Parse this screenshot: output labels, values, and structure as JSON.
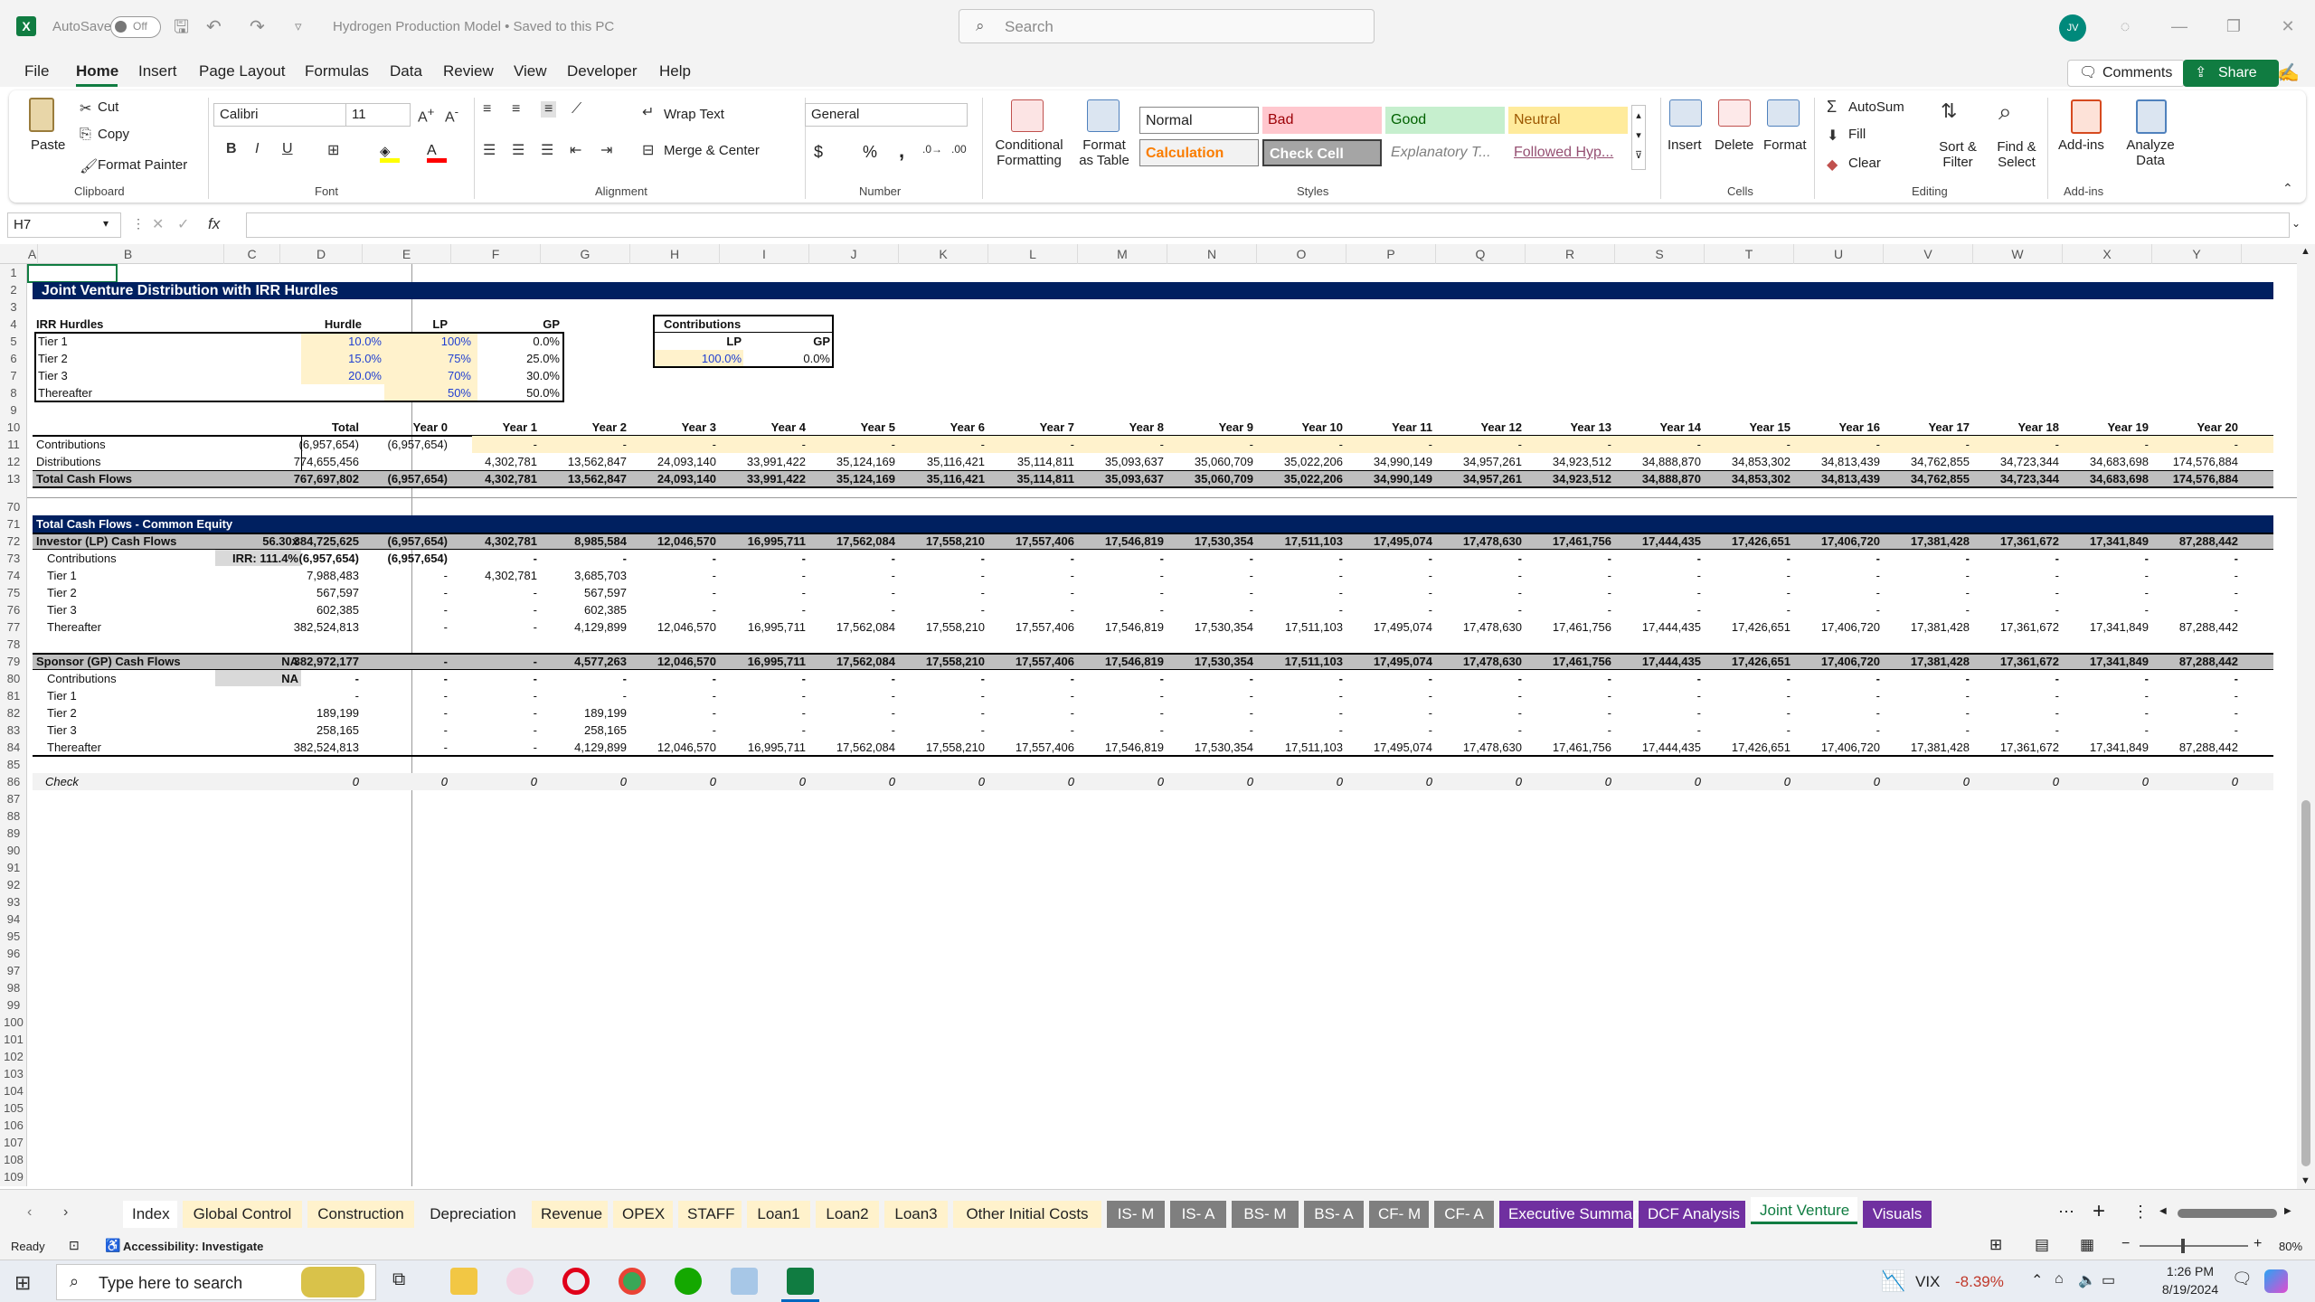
{
  "titlebar": {
    "autosave_label": "AutoSave",
    "autosave_state": "Off",
    "document_title": "Hydrogen Production Model • Saved to this PC",
    "search_placeholder": "Search",
    "user_initials": "JV"
  },
  "menu": {
    "tabs": [
      "File",
      "Home",
      "Insert",
      "Page Layout",
      "Formulas",
      "Data",
      "Review",
      "View",
      "Developer",
      "Help"
    ],
    "active": "Home",
    "comments_label": "Comments",
    "share_label": "Share"
  },
  "ribbon": {
    "clipboard": {
      "paste": "Paste",
      "cut": "Cut",
      "copy": "Copy",
      "format_painter": "Format Painter",
      "group": "Clipboard"
    },
    "font": {
      "name": "Calibri",
      "size": "11",
      "group": "Font"
    },
    "alignment": {
      "wrap_text": "Wrap Text",
      "merge_center": "Merge & Center",
      "group": "Alignment"
    },
    "number": {
      "format": "General",
      "currency": "$",
      "percent": "%",
      "comma": ",",
      "group": "Number"
    },
    "styles": {
      "conditional_formatting": "Conditional Formatting",
      "format_as_table": "Format as Table",
      "normal": "Normal",
      "bad": "Bad",
      "good": "Good",
      "neutral": "Neutral",
      "calculation": "Calculation",
      "check_cell": "Check Cell",
      "explanatory": "Explanatory T...",
      "followed": "Followed Hyp...",
      "group": "Styles"
    },
    "cells": {
      "insert": "Insert",
      "delete": "Delete",
      "format": "Format",
      "group": "Cells"
    },
    "editing": {
      "autosum": "AutoSum",
      "fill": "Fill",
      "clear": "Clear",
      "sort_filter": "Sort & Filter",
      "find_select": "Find & Select",
      "group": "Editing"
    },
    "addins": {
      "addins": "Add-ins",
      "analyze": "Analyze Data",
      "group": "Add-ins"
    }
  },
  "formula_bar": {
    "name_box": "H7",
    "fx": "fx",
    "content": ""
  },
  "columns": [
    "A",
    "B",
    "C",
    "D",
    "E",
    "F",
    "G",
    "H",
    "I",
    "J",
    "K",
    "L",
    "M",
    "N",
    "O",
    "P",
    "Q",
    "R",
    "S",
    "T",
    "U",
    "V",
    "W",
    "X",
    "Y"
  ],
  "row_numbers": [
    "1",
    "2",
    "3",
    "4",
    "5",
    "6",
    "7",
    "8",
    "9",
    "10",
    "11",
    "12",
    "13",
    "70",
    "71",
    "72",
    "73",
    "74",
    "75",
    "76",
    "77",
    "78",
    "79",
    "80",
    "81",
    "82",
    "83",
    "84",
    "85",
    "86",
    "87",
    "88",
    "89",
    "90",
    "91",
    "92",
    "93",
    "94",
    "95",
    "96",
    "97",
    "98",
    "99",
    "100",
    "101",
    "102",
    "103",
    "104",
    "105",
    "106",
    "107",
    "108",
    "109"
  ],
  "sheet": {
    "title": "Joint Venture Distribution with IRR Hurdles",
    "hurdles_header": {
      "label": "IRR Hurdles",
      "hurdle": "Hurdle",
      "lp": "LP",
      "gp": "GP"
    },
    "hurdles": [
      {
        "label": "Tier 1",
        "hurdle": "10.0%",
        "lp": "100%",
        "gp": "0.0%"
      },
      {
        "label": "Tier 2",
        "hurdle": "15.0%",
        "lp": "75%",
        "gp": "25.0%"
      },
      {
        "label": "Tier 3",
        "hurdle": "20.0%",
        "lp": "70%",
        "gp": "30.0%"
      },
      {
        "label": "Thereafter",
        "hurdle": "",
        "lp": "50%",
        "gp": "50.0%"
      }
    ],
    "contributions_box": {
      "title": "Contributions",
      "lp_label": "LP",
      "gp_label": "GP",
      "lp": "100.0%",
      "gp": "0.0%"
    },
    "year_header": [
      "Total",
      "Year 0",
      "Year 1",
      "Year 2",
      "Year 3",
      "Year 4",
      "Year 5",
      "Year 6",
      "Year 7",
      "Year 8",
      "Year 9",
      "Year 10",
      "Year 11",
      "Year 12",
      "Year 13",
      "Year 14",
      "Year 15",
      "Year 16",
      "Year 17",
      "Year 18",
      "Year 19",
      "Year 20"
    ],
    "cf_rows": [
      {
        "label": "Contributions",
        "values": [
          "(6,957,654)",
          "(6,957,654)",
          "-",
          "-",
          "-",
          "-",
          "-",
          "-",
          "-",
          "-",
          "-",
          "-",
          "-",
          "-",
          "-",
          "-",
          "-",
          "-",
          "-",
          "-",
          "-",
          "-"
        ]
      },
      {
        "label": "Distributions",
        "values": [
          "774,655,456",
          "",
          "4,302,781",
          "13,562,847",
          "24,093,140",
          "33,991,422",
          "35,124,169",
          "35,116,421",
          "35,114,811",
          "35,093,637",
          "35,060,709",
          "35,022,206",
          "34,990,149",
          "34,957,261",
          "34,923,512",
          "34,888,870",
          "34,853,302",
          "34,813,439",
          "34,762,855",
          "34,723,344",
          "34,683,698",
          "174,576,884"
        ]
      },
      {
        "label": "Total Cash Flows",
        "values": [
          "767,697,802",
          "(6,957,654)",
          "4,302,781",
          "13,562,847",
          "24,093,140",
          "33,991,422",
          "35,124,169",
          "35,116,421",
          "35,114,811",
          "35,093,637",
          "35,060,709",
          "35,022,206",
          "34,990,149",
          "34,957,261",
          "34,923,512",
          "34,888,870",
          "34,853,302",
          "34,813,439",
          "34,762,855",
          "34,723,344",
          "34,683,698",
          "174,576,884"
        ]
      }
    ],
    "common_equity_title": "Total Cash Flows - Common Equity",
    "lp_section": {
      "label": "Investor (LP) Cash Flows",
      "multiple": "56.30x",
      "values": [
        "384,725,625",
        "(6,957,654)",
        "4,302,781",
        "8,985,584",
        "12,046,570",
        "16,995,711",
        "17,562,084",
        "17,558,210",
        "17,557,406",
        "17,546,819",
        "17,530,354",
        "17,511,103",
        "17,495,074",
        "17,478,630",
        "17,461,756",
        "17,444,435",
        "17,426,651",
        "17,406,720",
        "17,381,428",
        "17,361,672",
        "17,341,849",
        "87,288,442"
      ],
      "rows": [
        {
          "label": "Contributions",
          "note": "IRR: 111.4%",
          "values": [
            "(6,957,654)",
            "(6,957,654)",
            "-",
            "-",
            "-",
            "-",
            "-",
            "-",
            "-",
            "-",
            "-",
            "-",
            "-",
            "-",
            "-",
            "-",
            "-",
            "-",
            "-",
            "-",
            "-",
            "-"
          ]
        },
        {
          "label": "Tier 1",
          "note": "",
          "values": [
            "7,988,483",
            "-",
            "4,302,781",
            "3,685,703",
            "-",
            "-",
            "-",
            "-",
            "-",
            "-",
            "-",
            "-",
            "-",
            "-",
            "-",
            "-",
            "-",
            "-",
            "-",
            "-",
            "-",
            "-"
          ]
        },
        {
          "label": "Tier 2",
          "note": "",
          "values": [
            "567,597",
            "-",
            "-",
            "567,597",
            "-",
            "-",
            "-",
            "-",
            "-",
            "-",
            "-",
            "-",
            "-",
            "-",
            "-",
            "-",
            "-",
            "-",
            "-",
            "-",
            "-",
            "-"
          ]
        },
        {
          "label": "Tier 3",
          "note": "",
          "values": [
            "602,385",
            "-",
            "-",
            "602,385",
            "-",
            "-",
            "-",
            "-",
            "-",
            "-",
            "-",
            "-",
            "-",
            "-",
            "-",
            "-",
            "-",
            "-",
            "-",
            "-",
            "-",
            "-"
          ]
        },
        {
          "label": "Thereafter",
          "note": "",
          "values": [
            "382,524,813",
            "-",
            "-",
            "4,129,899",
            "12,046,570",
            "16,995,711",
            "17,562,084",
            "17,558,210",
            "17,557,406",
            "17,546,819",
            "17,530,354",
            "17,511,103",
            "17,495,074",
            "17,478,630",
            "17,461,756",
            "17,444,435",
            "17,426,651",
            "17,406,720",
            "17,381,428",
            "17,361,672",
            "17,341,849",
            "87,288,442"
          ]
        }
      ]
    },
    "gp_section": {
      "label": "Sponsor (GP) Cash Flows",
      "multiple": "NA",
      "values": [
        "382,972,177",
        "-",
        "-",
        "4,577,263",
        "12,046,570",
        "16,995,711",
        "17,562,084",
        "17,558,210",
        "17,557,406",
        "17,546,819",
        "17,530,354",
        "17,511,103",
        "17,495,074",
        "17,478,630",
        "17,461,756",
        "17,444,435",
        "17,426,651",
        "17,406,720",
        "17,381,428",
        "17,361,672",
        "17,341,849",
        "87,288,442"
      ],
      "rows": [
        {
          "label": "Contributions",
          "note": "NA",
          "values": [
            "-",
            "-",
            "-",
            "-",
            "-",
            "-",
            "-",
            "-",
            "-",
            "-",
            "-",
            "-",
            "-",
            "-",
            "-",
            "-",
            "-",
            "-",
            "-",
            "-",
            "-",
            "-"
          ]
        },
        {
          "label": "Tier 1",
          "note": "",
          "values": [
            "-",
            "-",
            "-",
            "-",
            "-",
            "-",
            "-",
            "-",
            "-",
            "-",
            "-",
            "-",
            "-",
            "-",
            "-",
            "-",
            "-",
            "-",
            "-",
            "-",
            "-",
            "-"
          ]
        },
        {
          "label": "Tier 2",
          "note": "",
          "values": [
            "189,199",
            "-",
            "-",
            "189,199",
            "-",
            "-",
            "-",
            "-",
            "-",
            "-",
            "-",
            "-",
            "-",
            "-",
            "-",
            "-",
            "-",
            "-",
            "-",
            "-",
            "-",
            "-"
          ]
        },
        {
          "label": "Tier 3",
          "note": "",
          "values": [
            "258,165",
            "-",
            "-",
            "258,165",
            "-",
            "-",
            "-",
            "-",
            "-",
            "-",
            "-",
            "-",
            "-",
            "-",
            "-",
            "-",
            "-",
            "-",
            "-",
            "-",
            "-",
            "-"
          ]
        },
        {
          "label": "Thereafter",
          "note": "",
          "values": [
            "382,524,813",
            "-",
            "-",
            "4,129,899",
            "12,046,570",
            "16,995,711",
            "17,562,084",
            "17,558,210",
            "17,557,406",
            "17,546,819",
            "17,530,354",
            "17,511,103",
            "17,495,074",
            "17,478,630",
            "17,461,756",
            "17,444,435",
            "17,426,651",
            "17,406,720",
            "17,381,428",
            "17,361,672",
            "17,341,849",
            "87,288,442"
          ]
        }
      ]
    },
    "check": {
      "label": "Check",
      "values": [
        "0",
        "0",
        "0",
        "0",
        "0",
        "0",
        "0",
        "0",
        "0",
        "0",
        "0",
        "0",
        "0",
        "0",
        "0",
        "0",
        "0",
        "0",
        "0",
        "0",
        "0",
        "0"
      ]
    }
  },
  "sheet_tabs": [
    {
      "name": "Index",
      "color": "#ffffff"
    },
    {
      "name": "Global Control",
      "color": "#fff2cc"
    },
    {
      "name": "Construction",
      "color": "#fff2cc"
    },
    {
      "name": "Depreciation",
      "color": "#f3f3f3"
    },
    {
      "name": "Revenue",
      "color": "#fff2cc"
    },
    {
      "name": "OPEX",
      "color": "#fff2cc"
    },
    {
      "name": "STAFF",
      "color": "#fff2cc"
    },
    {
      "name": "Loan1",
      "color": "#fff2cc"
    },
    {
      "name": "Loan2",
      "color": "#fff2cc"
    },
    {
      "name": "Loan3",
      "color": "#fff2cc"
    },
    {
      "name": "Other Initial Costs",
      "color": "#fff2cc"
    },
    {
      "name": "IS- M",
      "color": "#7f7f7f"
    },
    {
      "name": "IS- A",
      "color": "#7f7f7f"
    },
    {
      "name": "BS- M",
      "color": "#7f7f7f"
    },
    {
      "name": "BS- A",
      "color": "#7f7f7f"
    },
    {
      "name": "CF- M",
      "color": "#7f7f7f"
    },
    {
      "name": "CF- A",
      "color": "#7f7f7f"
    },
    {
      "name": "Executive Summary",
      "color": "#7030a0"
    },
    {
      "name": "DCF Analysis",
      "color": "#7030a0"
    },
    {
      "name": "Joint Venture",
      "color": "#ffffff"
    },
    {
      "name": "Visuals",
      "color": "#7030a0"
    }
  ],
  "active_sheet": "Joint Venture",
  "status": {
    "ready": "Ready",
    "accessibility": "Accessibility: Investigate",
    "zoom": "80%"
  },
  "taskbar": {
    "search_placeholder": "Type here to search",
    "vix_label": "VIX",
    "vix_change": "-8.39%",
    "time": "1:26 PM",
    "date": "8/19/2024"
  }
}
